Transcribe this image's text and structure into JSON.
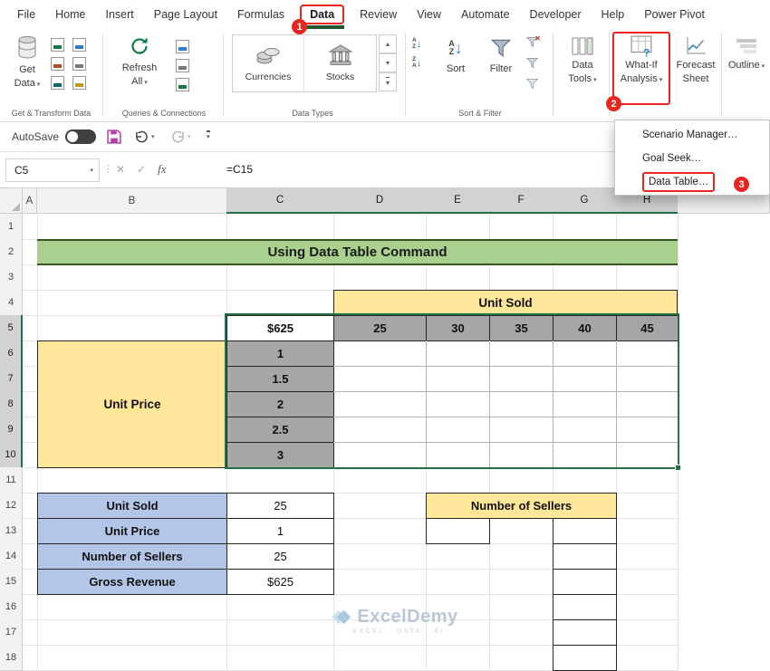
{
  "menubar": {
    "tabs": [
      "File",
      "Home",
      "Insert",
      "Page Layout",
      "Formulas",
      "Data",
      "Review",
      "View",
      "Automate",
      "Developer",
      "Help",
      "Power Pivot"
    ]
  },
  "annotations": {
    "step1": "1",
    "step2": "2",
    "step3": "3"
  },
  "ribbon": {
    "groups": {
      "get_transform": {
        "label": "Get & Transform Data",
        "get_data": {
          "line1": "Get",
          "line2": "Data"
        }
      },
      "queries": {
        "label": "Queries & Connections",
        "refresh": {
          "line1": "Refresh",
          "line2": "All"
        }
      },
      "data_types": {
        "label": "Data Types",
        "currencies": "Currencies",
        "stocks": "Stocks"
      },
      "sort_filter": {
        "label": "Sort & Filter",
        "sort": "Sort",
        "filter": "Filter"
      },
      "data_tools": {
        "line1": "Data",
        "line2": "Tools"
      },
      "what_if": {
        "line1": "What-If",
        "line2": "Analysis"
      },
      "forecast": {
        "line1": "Forecast",
        "line2": "Sheet"
      },
      "outline": {
        "label": "Outline"
      }
    }
  },
  "quick_access": {
    "autosave_label": "AutoSave"
  },
  "formula_bar": {
    "name_box": "C5",
    "fx_label": "fx",
    "formula": "=C15"
  },
  "whatif_menu": {
    "items": [
      "Scenario Manager…",
      "Goal Seek…",
      "Data Table…"
    ]
  },
  "sheet": {
    "col_headers": [
      "A",
      "B",
      "C",
      "D",
      "E",
      "F",
      "G",
      "H"
    ],
    "row_headers": [
      "1",
      "2",
      "3",
      "4",
      "5",
      "6",
      "7",
      "8",
      "9",
      "10",
      "11",
      "12",
      "13",
      "14",
      "15",
      "16",
      "17",
      "18"
    ],
    "title": "Using Data Table Command",
    "data_table": {
      "input_value": "$625",
      "col_title": "Unit Sold",
      "col_values": [
        "25",
        "30",
        "35",
        "40",
        "45"
      ],
      "row_title": "Unit Price",
      "row_values": [
        "1",
        "1.5",
        "2",
        "2.5",
        "3"
      ]
    },
    "summary": {
      "rows": [
        {
          "label": "Unit Sold",
          "value": "25"
        },
        {
          "label": "Unit Price",
          "value": "1"
        },
        {
          "label": "Number of Sellers",
          "value": "25"
        },
        {
          "label": "Gross Revenue",
          "value": "$625"
        }
      ]
    },
    "sellers_title": "Number of Sellers",
    "watermark": {
      "name": "ExcelDemy",
      "tagline": "EXCEL · DATA · BI"
    }
  }
}
